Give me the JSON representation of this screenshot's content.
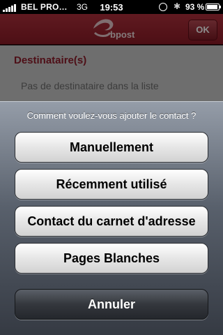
{
  "status_bar": {
    "carrier": "BEL PRO…",
    "network": "3G",
    "time": "19:53",
    "battery_percent": "93 %",
    "battery_level": 0.93,
    "icons": [
      "signal-icon",
      "lock-rotation-icon",
      "bluetooth-icon",
      "battery-icon"
    ]
  },
  "navbar": {
    "logo_text": "bpost",
    "ok_label": "OK",
    "color": "#9e2430"
  },
  "content": {
    "section_title": "Destinataire(s)",
    "empty_text": "Pas de destinataire dans la liste"
  },
  "action_sheet": {
    "title": "Comment voulez-vous ajouter le contact ?",
    "options": [
      "Manuellement",
      "Récemment utilisé",
      "Contact du carnet d'adresse",
      "Pages Blanches"
    ],
    "cancel_label": "Annuler"
  }
}
